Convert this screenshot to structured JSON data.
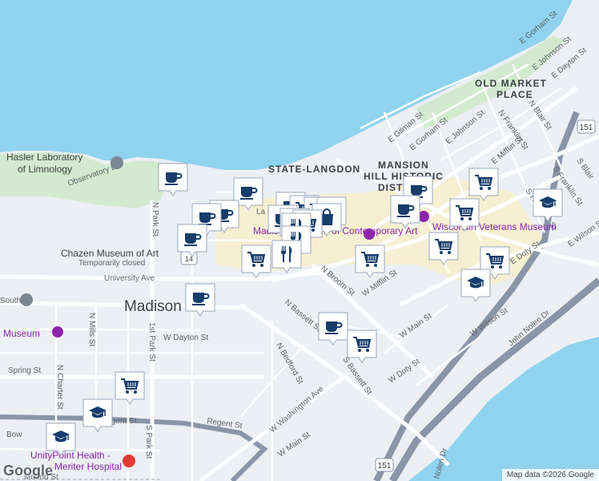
{
  "map": {
    "colors": {
      "water": "#8fd3ef",
      "land": "#eceff3",
      "highway": "#8a95a8",
      "road": "#ffffff",
      "park": "#d4ead0",
      "highlight": "#f6efd2"
    },
    "districts": [
      "STATE-LANGDON",
      "OLD MARKET",
      "PLACE",
      "MANSION",
      "HILL HISTORIC",
      "DIST"
    ],
    "city_label": "Madison",
    "pois": [
      "Hasler Laboratory",
      "of Limnology",
      "Chazen Museum of Art",
      "Temporarily closed",
      "Wisconsin Veterans Museum",
      "Madison Museum of Contemporary Art",
      "Museum",
      "UnityPoint Health -",
      "Meriter Hospital"
    ],
    "streets": {
      "e_gorham_1": "E Gorham St",
      "e_gorham_2": "E Gorham St",
      "e_johnson_1": "E Johnson St",
      "e_johnson_2": "E Johnson St",
      "e_dayton": "E Dayton St",
      "e_gilman": "E Gilman St",
      "n_blair": "N Blair St",
      "n_franklin": "N Franklin St",
      "e_mifflin": "E Mifflin St",
      "s_blair": "S Blair",
      "s_franklin": "S Franklin St",
      "s_hancock": "S Hancock St",
      "e_wilson": "E Wilson St",
      "e_doty": "E Doty St",
      "w_wilson": "W Wilson St",
      "john_nolen": "John Nolen Dr",
      "nolen_dr": "Nolen Dr",
      "w_doty": "W Doty St",
      "w_main_1": "W Main St",
      "w_main_2": "W Main St",
      "w_mifflin": "W Mifflin St",
      "n_broom": "N Broom St",
      "n_bassett": "N Bassett St",
      "s_bassett": "S Bassett St",
      "w_washington": "W Washington Ave",
      "n_bedford": "N Bedford St",
      "regent_1": "Regent St",
      "regent_2": "Regent St",
      "w_dayton": "W Dayton St",
      "university": "University Ave",
      "observatory": "Observatory Dr",
      "n_park": "N Park St",
      "s_park": "S Park St",
      "park_1st": "1st Park St",
      "n_mills": "N Mills St",
      "n_charter": "N Charter St",
      "spring": "Spring St",
      "bow": "Bow",
      "mound": "Mound St",
      "south": "South",
      "langdon": "La"
    },
    "shields": {
      "s151_top": "151",
      "s151_bottom": "151",
      "s14": "14"
    },
    "attribution": "Map data ©2026 Google",
    "logo": "Google"
  }
}
